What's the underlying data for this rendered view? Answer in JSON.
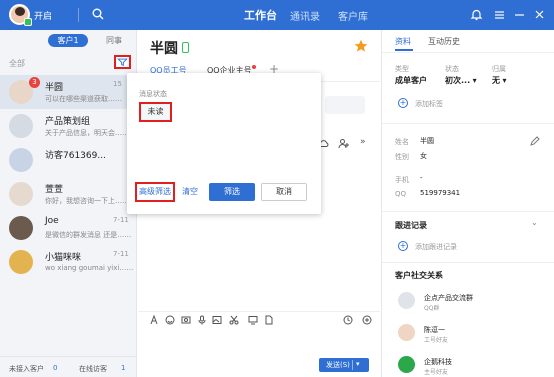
{
  "topbar": {
    "status": "开启",
    "nav": [
      "工作台",
      "通讯录",
      "客户库"
    ]
  },
  "left": {
    "tab_customer": "客户1",
    "tab_colleague": "同事",
    "filter_all": "全部",
    "conversations": [
      {
        "name": "半圆",
        "preview": "可以在哪些渠道获取……",
        "time": "15",
        "badge": "3",
        "active": true,
        "avatar_color": "#e8d6c8"
      },
      {
        "name": "产品策划组",
        "preview": "关于产品信息，明天会……",
        "time": "",
        "badge": "",
        "active": false,
        "avatar_color": "#d5dbe3"
      },
      {
        "name": "访客761369...",
        "preview": "",
        "time": "",
        "badge": "",
        "active": false,
        "avatar_color": "#c9d3e6"
      },
      {
        "name": "萱萱",
        "preview": "你好，我想咨询一下上……",
        "time": "",
        "badge": "",
        "active": false,
        "avatar_color": "#e6d9cf"
      },
      {
        "name": "Joe",
        "preview": "是微信的群发消息 还是……",
        "time": "7-11",
        "badge": "",
        "active": false,
        "avatar_color": "#6b5b4e"
      },
      {
        "name": "小猫咪咪",
        "preview": "wo xiang goumai yixi……",
        "time": "7-11",
        "badge": "",
        "active": false,
        "avatar_color": "#e3b34f"
      }
    ],
    "bottom_not_joined": "未接入客户",
    "bottom_not_joined_count": "0",
    "bottom_online": "在线访客",
    "bottom_online_count": "1"
  },
  "center": {
    "title": "半圆",
    "tab_qq": "QQ员工号",
    "tab_enterprise": "QQ企业主号",
    "send_label": "发送(S)"
  },
  "popup": {
    "label": "消息状态",
    "unread": "未读",
    "advanced": "高级筛选",
    "clear": "清空",
    "confirm": "筛选",
    "cancel": "取消"
  },
  "right": {
    "tab_data": "资料",
    "tab_history": "互动历史",
    "type_label": "类型",
    "type_value": "成单客户",
    "status_label": "状态",
    "status_value": "初次...",
    "owner_label": "归属",
    "owner_value": "无",
    "add_tag": "添加标签",
    "name_label": "姓名",
    "name_value": "半圆",
    "gender_label": "性别",
    "gender_value": "女",
    "phone_label": "手机",
    "phone_value": "-",
    "qq_label": "QQ",
    "qq_value": "519979341",
    "follow_title": "跟进记录",
    "add_follow": "添加跟进记录",
    "social_title": "客户社交关系",
    "social": [
      {
        "name": "企点产品交流群",
        "sub": "QQ群",
        "color": "#dfe4ea"
      },
      {
        "name": "陈逗一",
        "sub": "工号好友",
        "color": "#f0d4c4"
      },
      {
        "name": "企鹅科技",
        "sub": "主号好友",
        "color": "#2aa84a"
      }
    ]
  }
}
